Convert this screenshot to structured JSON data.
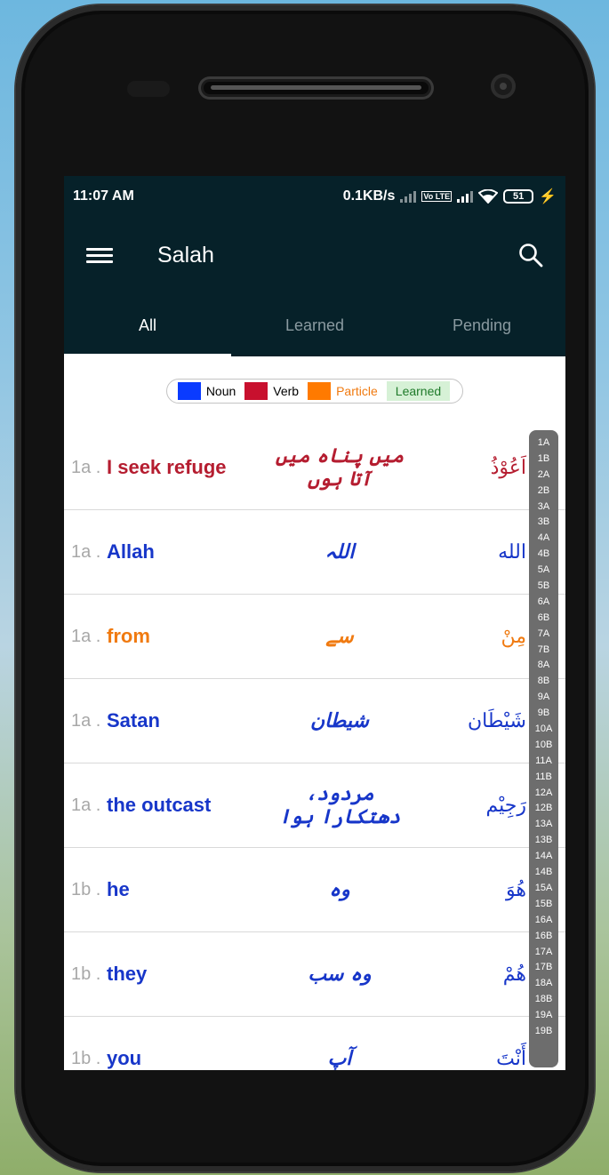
{
  "status_bar": {
    "time": "11:07 AM",
    "speed": "0.1KB/s",
    "battery": "51",
    "volte": "Vo LTE"
  },
  "app_bar": {
    "title": "Salah"
  },
  "tabs": [
    {
      "label": "All",
      "active": true
    },
    {
      "label": "Learned",
      "active": false
    },
    {
      "label": "Pending",
      "active": false
    }
  ],
  "legend": {
    "noun": "Noun",
    "verb": "Verb",
    "particle": "Particle",
    "learned": "Learned",
    "colors": {
      "noun": "#0a3bff",
      "verb": "#c8102e",
      "particle": "#ff7a00",
      "learned": "#d6f1d6"
    }
  },
  "words": [
    {
      "num": "1a .",
      "en": "I seek refuge",
      "ur": "میں پناہ میں آتا ہوں",
      "ar": "اَعُوْذُ",
      "type": "verb"
    },
    {
      "num": "1a .",
      "en": "Allah",
      "ur": "اللہ",
      "ar": "الله",
      "type": "noun"
    },
    {
      "num": "1a .",
      "en": "from",
      "ur": "سے",
      "ar": "مِنْ",
      "type": "particle"
    },
    {
      "num": "1a .",
      "en": "Satan",
      "ur": "شیطان",
      "ar": "شَيْطَان",
      "type": "noun"
    },
    {
      "num": "1a .",
      "en": "the outcast",
      "ur": "مردود، دھتکارا ہوا",
      "ar": "رَجِيْم",
      "type": "noun"
    },
    {
      "num": "1b .",
      "en": "he",
      "ur": "وہ",
      "ar": "هُوَ",
      "type": "noun"
    },
    {
      "num": "1b .",
      "en": "they",
      "ur": "وہ سب",
      "ar": "هُمْ",
      "type": "noun"
    },
    {
      "num": "1b .",
      "en": "you",
      "ur": "آپ",
      "ar": "أَنْتَ",
      "type": "noun"
    }
  ],
  "index": [
    "1A",
    "1B",
    "2A",
    "2B",
    "3A",
    "3B",
    "4A",
    "4B",
    "5A",
    "5B",
    "6A",
    "6B",
    "7A",
    "7B",
    "8A",
    "8B",
    "9A",
    "9B",
    "10A",
    "10B",
    "11A",
    "11B",
    "12A",
    "12B",
    "13A",
    "13B",
    "14A",
    "14B",
    "15A",
    "15B",
    "16A",
    "16B",
    "17A",
    "17B",
    "18A",
    "18B",
    "19A",
    "19B"
  ]
}
